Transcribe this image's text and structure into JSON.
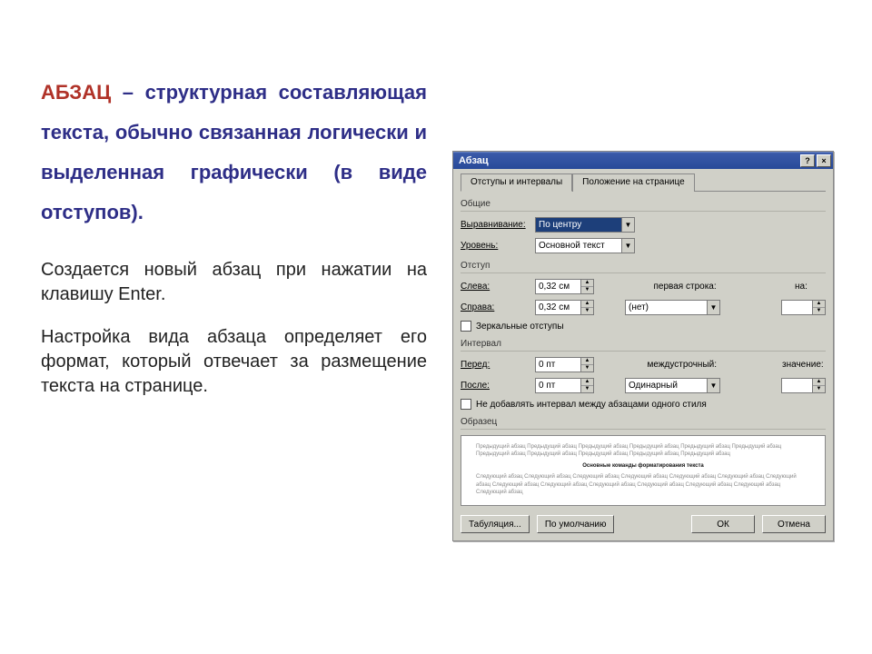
{
  "text": {
    "headline_first": "АБЗАЦ",
    "headline_rest": " – структурная составляющая текста, обычно связанная логически и выделенная графически (в виде отступов).",
    "para1": "Создается новый абзац при нажатии на клавишу Enter.",
    "para2": "Настройка вида абзаца определяет его формат, который отвечает за размещение текста на странице."
  },
  "dialog": {
    "title": "Абзац",
    "help_btn": "?",
    "close_btn": "×",
    "tabs": {
      "active": "Отступы и интервалы",
      "inactive": "Положение на странице"
    },
    "general": {
      "group": "Общие",
      "alignment_label": "Выравнивание:",
      "alignment_value": "По центру",
      "level_label": "Уровень:",
      "level_value": "Основной текст"
    },
    "indent": {
      "group": "Отступ",
      "left_label": "Слева:",
      "left_value": "0,32 см",
      "right_label": "Справа:",
      "right_value": "0,32 см",
      "firstline_label": "первая строка:",
      "firstline_value": "(нет)",
      "by_label": "на:",
      "by_value": "",
      "mirror_label": "Зеркальные отступы"
    },
    "spacing": {
      "group": "Интервал",
      "before_label": "Перед:",
      "before_value": "0 пт",
      "after_label": "После:",
      "after_value": "0 пт",
      "linespacing_label": "междустрочный:",
      "linespacing_value": "Одинарный",
      "at_label": "значение:",
      "at_value": "",
      "no_space_label": "Не добавлять интервал между абзацами одного стиля"
    },
    "preview": {
      "group": "Образец",
      "before": "Предыдущий абзац Предыдущий абзац Предыдущий абзац Предыдущий абзац Предыдущий абзац Предыдущий абзац Предыдущий абзац Предыдущий абзац Предыдущий абзац Предыдущий абзац Предыдущий абзац",
      "sample": "Основные команды форматирования текста",
      "after": "Следующий абзац Следующий абзац Следующий абзац Следующий абзац Следующий абзац Следующий абзац Следующий абзац Следующий абзац Следующий абзац Следующий абзац Следующий абзац Следующий абзац Следующий абзац Следующий абзац"
    },
    "buttons": {
      "tabs": "Табуляция...",
      "default": "По умолчанию",
      "ok": "ОК",
      "cancel": "Отмена"
    }
  }
}
